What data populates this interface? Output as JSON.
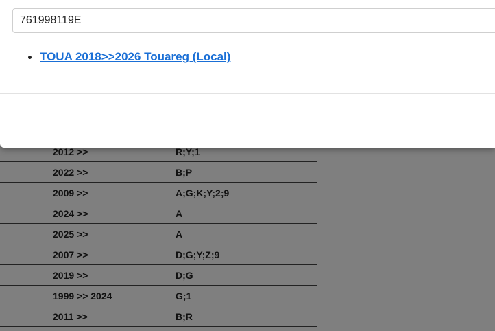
{
  "search": {
    "value": "761998119E"
  },
  "results": [
    {
      "label": "TOUA 2018>>2026 Touareg (Local)"
    }
  ],
  "table": {
    "rows": [
      {
        "years": "2012 >>",
        "codes": "R;Y;1"
      },
      {
        "years": "2022 >>",
        "codes": "B;P"
      },
      {
        "years": "2009 >>",
        "codes": "A;G;K;Y;2;9"
      },
      {
        "years": "2024 >>",
        "codes": "A"
      },
      {
        "years": "2025 >>",
        "codes": "A"
      },
      {
        "years": "2007 >>",
        "codes": "D;G;Y;Z;9"
      },
      {
        "years": "2019 >>",
        "codes": "D;G"
      },
      {
        "years": "1999 >> 2024",
        "codes": "G;1"
      },
      {
        "years": "2011 >>",
        "codes": "B;R"
      }
    ]
  }
}
